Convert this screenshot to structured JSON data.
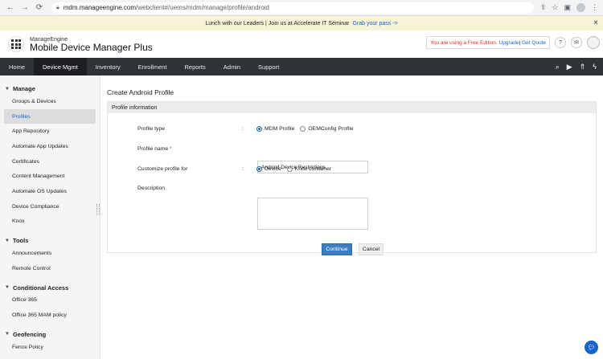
{
  "browser": {
    "back_icon": "back-arrow-icon",
    "forward_icon": "forward-arrow-icon",
    "reload_icon": "reload-icon",
    "url_host": "mdm.manageengine.com",
    "url_path": "/webclient#/uems/mdm/manage/profile/android"
  },
  "banner": {
    "text": "Lunch with our Leaders | Join us at Accelerate IT Seminar",
    "link": "Grab your pass ->"
  },
  "header": {
    "brand_top": "ManageEngine",
    "brand_name": "Mobile Device Manager Plus",
    "edition_text": "You are using a Free Edition.",
    "upgrade": "Upgrade",
    "separator": "|",
    "quote": "Get Quote",
    "help_label": "?"
  },
  "navbar": {
    "items": [
      {
        "label": "Home"
      },
      {
        "label": "Device Mgmt"
      },
      {
        "label": "Inventory"
      },
      {
        "label": "Enrollment"
      },
      {
        "label": "Reports"
      },
      {
        "label": "Admin"
      },
      {
        "label": "Support"
      }
    ],
    "active_index": 1
  },
  "sidebar": {
    "manage": {
      "title": "Manage",
      "items": [
        {
          "label": "Groups & Devices"
        },
        {
          "label": "Profiles"
        },
        {
          "label": "App Repository"
        },
        {
          "label": "Automate App Updates"
        },
        {
          "label": "Certificates"
        },
        {
          "label": "Content Management"
        },
        {
          "label": "Automate OS Updates"
        },
        {
          "label": "Device Compliance"
        },
        {
          "label": "Knox"
        }
      ]
    },
    "tools": {
      "title": "Tools",
      "items": [
        {
          "label": "Announcements"
        },
        {
          "label": "Remote Control"
        }
      ]
    },
    "conditional": {
      "title": "Conditional Access",
      "items": [
        {
          "label": "Office 365"
        },
        {
          "label": "Office 365 MAM policy"
        }
      ]
    },
    "geofencing": {
      "title": "Geofencing",
      "items": [
        {
          "label": "Fence Policy"
        }
      ]
    }
  },
  "page": {
    "title": "Create Android Profile",
    "panel_title": "Profile information",
    "profile_type_label": "Profile type",
    "profile_type_options": [
      "MDM Profile",
      "OEMConfig Profile"
    ],
    "profile_type_selected": "MDM Profile",
    "profile_name_label": "Profile name",
    "required_mark": "*",
    "profile_name_value": "Android Device Restrictions",
    "customize_label": "Customize profile for",
    "customize_options": [
      "Device",
      "Knox container"
    ],
    "customize_selected": "Device",
    "description_label": "Description",
    "description_value": "",
    "colon": ":",
    "continue_label": "Continue",
    "cancel_label": "Cancel"
  },
  "colors": {
    "accent": "#1a63c9",
    "navbar": "#2f3237",
    "primary_button": "#3d7dc4"
  }
}
